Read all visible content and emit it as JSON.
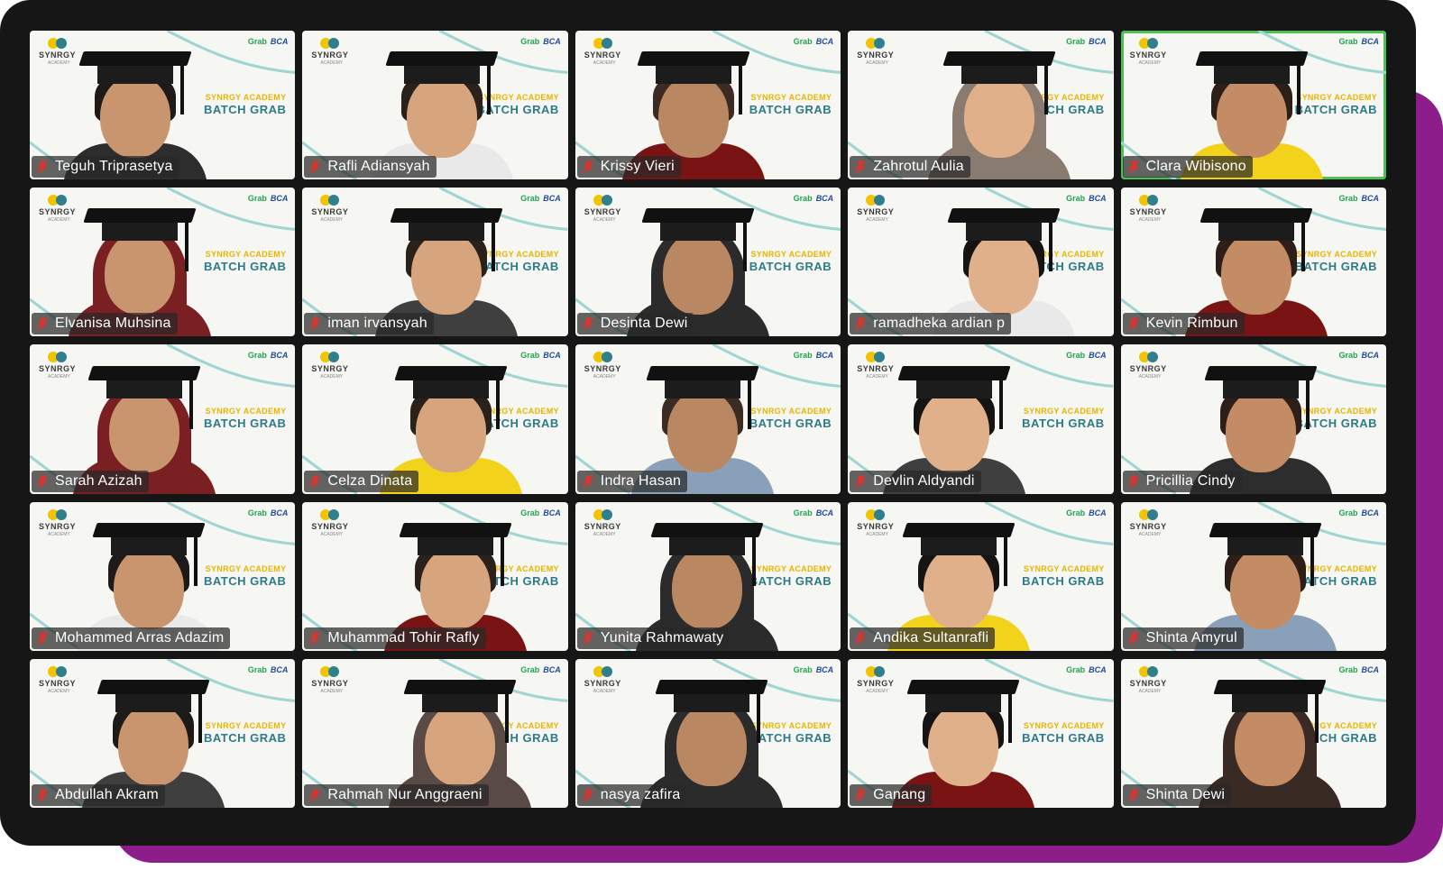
{
  "window": {
    "accent_color": "#8c1d8a",
    "frame_color": "#161616",
    "active_speaker_color": "#4cbf56",
    "muted_icon": "mic-muted-icon",
    "muted_icon_color": "#e0322c"
  },
  "background_branding": {
    "logo_text": "SYNRGY",
    "logo_sub": "ACADEMY",
    "sponsor_1": "Grab",
    "sponsor_2": "BCA",
    "banner_line_1": "SYNRGY ACADEMY",
    "banner_line_2": "BATCH GRAB"
  },
  "participants": [
    {
      "name": "Teguh Triprasetya",
      "muted": true,
      "active": false
    },
    {
      "name": "Rafli Adiansyah",
      "muted": true,
      "active": false
    },
    {
      "name": "Krissy Vieri",
      "muted": true,
      "active": false
    },
    {
      "name": "Zahrotul Aulia",
      "muted": true,
      "active": false
    },
    {
      "name": "Clara Wibisono",
      "muted": true,
      "active": true
    },
    {
      "name": "Elvanisa Muhsina",
      "muted": true,
      "active": false
    },
    {
      "name": "iman irvansyah",
      "muted": true,
      "active": false
    },
    {
      "name": "Desinta Dewi",
      "muted": true,
      "active": false
    },
    {
      "name": "ramadheka ardian p",
      "muted": true,
      "active": false
    },
    {
      "name": "Kevin Rimbun",
      "muted": true,
      "active": false
    },
    {
      "name": "Sarah Azizah",
      "muted": true,
      "active": false
    },
    {
      "name": "Celza Dinata",
      "muted": true,
      "active": false
    },
    {
      "name": "Indra Hasan",
      "muted": true,
      "active": false
    },
    {
      "name": "Devlin Aldyandi",
      "muted": true,
      "active": false
    },
    {
      "name": "Pricillia Cindy",
      "muted": true,
      "active": false
    },
    {
      "name": "Mohammed Arras Adazim",
      "muted": true,
      "active": false
    },
    {
      "name": "Muhammad Tohir Rafly",
      "muted": true,
      "active": false
    },
    {
      "name": "Yunita Rahmawaty",
      "muted": true,
      "active": false
    },
    {
      "name": "Andika Sultanrafli",
      "muted": true,
      "active": false
    },
    {
      "name": "Shinta Amyrul",
      "muted": true,
      "active": false
    },
    {
      "name": "Abdullah Akram",
      "muted": true,
      "active": false
    },
    {
      "name": "Rahmah Nur Anggraeni",
      "muted": true,
      "active": false
    },
    {
      "name": "nasya zafira",
      "muted": true,
      "active": false
    },
    {
      "name": "Ganang",
      "muted": true,
      "active": false
    },
    {
      "name": "Shinta Dewi",
      "muted": true,
      "active": false
    }
  ]
}
